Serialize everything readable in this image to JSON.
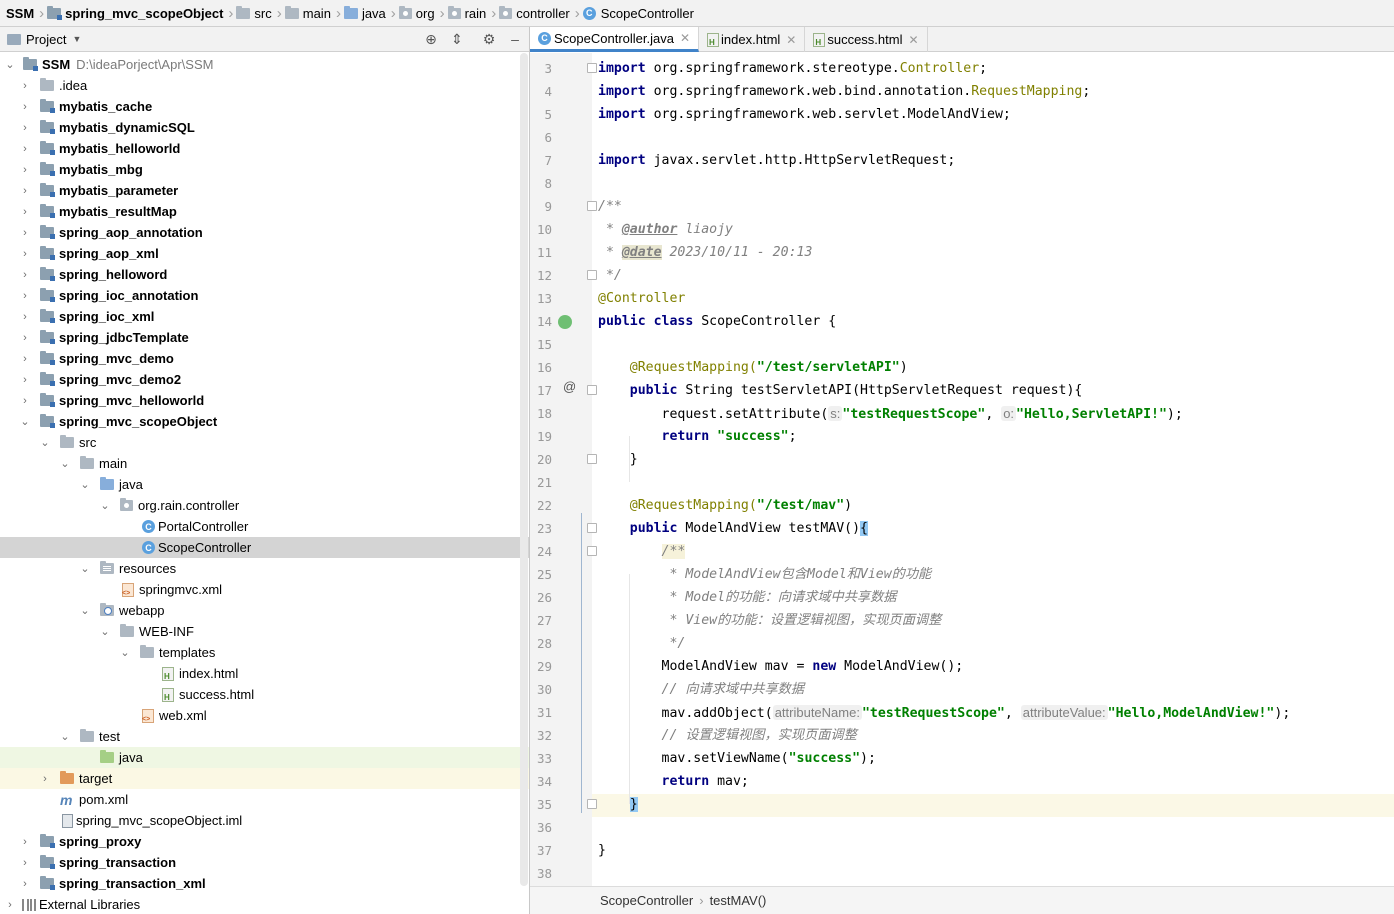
{
  "breadcrumb": [
    "SSM",
    "spring_mvc_scopeObject",
    "src",
    "main",
    "java",
    "org",
    "rain",
    "controller",
    "ScopeController"
  ],
  "project_panel": {
    "title": "Project"
  },
  "tree": [
    {
      "label": "SSM",
      "path": "D:\\ideaPorject\\Apr\\SSM"
    },
    {
      "label": ".idea"
    },
    {
      "label": "mybatis_cache"
    },
    {
      "label": "mybatis_dynamicSQL"
    },
    {
      "label": "mybatis_helloworld"
    },
    {
      "label": "mybatis_mbg"
    },
    {
      "label": "mybatis_parameter"
    },
    {
      "label": "mybatis_resultMap"
    },
    {
      "label": "spring_aop_annotation"
    },
    {
      "label": "spring_aop_xml"
    },
    {
      "label": "spring_helloword"
    },
    {
      "label": "spring_ioc_annotation"
    },
    {
      "label": "spring_ioc_xml"
    },
    {
      "label": "spring_jdbcTemplate"
    },
    {
      "label": "spring_mvc_demo"
    },
    {
      "label": "spring_mvc_demo2"
    },
    {
      "label": "spring_mvc_helloworld"
    },
    {
      "label": "spring_mvc_scopeObject"
    },
    {
      "label": "src"
    },
    {
      "label": "main"
    },
    {
      "label": "java"
    },
    {
      "label": "org.rain.controller"
    },
    {
      "label": "PortalController"
    },
    {
      "label": "ScopeController"
    },
    {
      "label": "resources"
    },
    {
      "label": "springmvc.xml"
    },
    {
      "label": "webapp"
    },
    {
      "label": "WEB-INF"
    },
    {
      "label": "templates"
    },
    {
      "label": "index.html"
    },
    {
      "label": "success.html"
    },
    {
      "label": "web.xml"
    },
    {
      "label": "test"
    },
    {
      "label": "java"
    },
    {
      "label": "target"
    },
    {
      "label": "pom.xml"
    },
    {
      "label": "spring_mvc_scopeObject.iml"
    },
    {
      "label": "spring_proxy"
    },
    {
      "label": "spring_transaction"
    },
    {
      "label": "spring_transaction_xml"
    },
    {
      "label": "External Libraries"
    }
  ],
  "tabs": [
    {
      "label": "ScopeController.java",
      "active": true
    },
    {
      "label": "index.html"
    },
    {
      "label": "success.html"
    }
  ],
  "line_numbers": [
    "3",
    "4",
    "5",
    "6",
    "7",
    "8",
    "9",
    "10",
    "11",
    "12",
    "13",
    "14",
    "15",
    "16",
    "17",
    "18",
    "19",
    "20",
    "21",
    "22",
    "23",
    "24",
    "25",
    "26",
    "27",
    "28",
    "29",
    "30",
    "31",
    "32",
    "33",
    "34",
    "35",
    "36",
    "37",
    "38"
  ],
  "code": {
    "l3": "org.springframework.stereotype.",
    "l3b": "Controller",
    "l4": "org.springframework.web.bind.annotation.",
    "l4b": "RequestMapping",
    "l5": "org.springframework.web.servlet.ModelAndView;",
    "l7": "javax.servlet.http.HttpServletRequest;",
    "import_kw": "import",
    "l9": "/**",
    "author_tag": "@author",
    "author_val": " liaojy",
    "date_tag": "@date",
    "date_val": " 2023/10/11 - 20:13",
    "l12": " */",
    "l13": "@Controller",
    "l14_kw": "public class",
    "l14_rest": " ScopeController {",
    "rm1": "@RequestMapping(",
    "rm1_str": "\"/test/servletAPI\"",
    "public_kw": "public",
    "l17_rest": " String testServletAPI(HttpServletRequest request){",
    "l18_a": "request.setAttribute(",
    "hint_s": "s:",
    "l18_str1": "\"testRequestScope\"",
    "hint_o": "o:",
    "l18_str2": "\"Hello,ServletAPI!\"",
    "return_kw": "return",
    "l19_str": "\"success\"",
    "rm2_str": "\"/test/mav\"",
    "l23_rest": " ModelAndView testMAV()",
    "l24": "/**",
    "l25": " * ModelAndView包含Model和View的功能",
    "l26": " * Model的功能：向请求域中共享数据",
    "l27": " * View的功能：设置逻辑视图，实现页面调整",
    "l28": " */",
    "l29_a": "ModelAndView mav = ",
    "new_kw": "new",
    "l29_b": " ModelAndView();",
    "l30": "// 向请求域中共享数据",
    "l31_a": "mav.addObject(",
    "hint_attrName": "attributeName:",
    "l31_str1": "\"testRequestScope\"",
    "hint_attrValue": "attributeValue:",
    "l31_str2": "\"Hello,ModelAndView!\"",
    "l32": "// 设置逻辑视图，实现页面调整",
    "l33_a": "mav.setViewName(",
    "l33_str": "\"success\"",
    "l34_rest": " mav;"
  },
  "status_path": [
    "ScopeController",
    "testMAV()"
  ]
}
